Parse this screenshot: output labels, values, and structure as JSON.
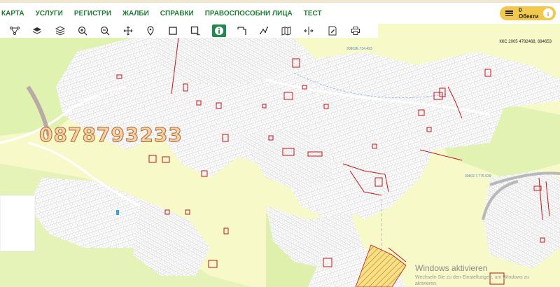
{
  "nav": {
    "items": [
      "КАРТА",
      "УСЛУГИ",
      "РЕГИСТРИ",
      "ЖАЛБИ",
      "СПРАВКИ",
      "ПРАВОСПОСОБНИ ЛИЦА",
      "ТЕСТ"
    ]
  },
  "objects_button": {
    "label": "0 Обекти"
  },
  "toolbar": {
    "tools": [
      "network-icon",
      "layers-filled-icon",
      "layers-icon",
      "zoom-in-icon",
      "zoom-out-icon",
      "pan-icon",
      "location-pin-icon",
      "select-rect-icon",
      "select-rect-minus-icon",
      "info-icon",
      "measure-area-icon",
      "measure-line-icon",
      "map-icon",
      "split-icon",
      "edit-doc-icon",
      "print-icon"
    ],
    "active": "info-icon"
  },
  "map": {
    "coordinates": "ККС 2005 4782468, 694653",
    "phone_overlay": "0878793233",
    "labels": [
      "30802E.734.493",
      "30802.7.775.539"
    ]
  },
  "watermark": {
    "title": "Windows aktivieren",
    "subtitle": "Wechseln Sie zu den Einstellungen, um Windows zu aktivieren."
  },
  "colors": {
    "accent_green": "#1f7a34",
    "button_yellow": "#f2c94c",
    "map_base": "#f7f9c9",
    "parcel_red": "#c0151b"
  }
}
